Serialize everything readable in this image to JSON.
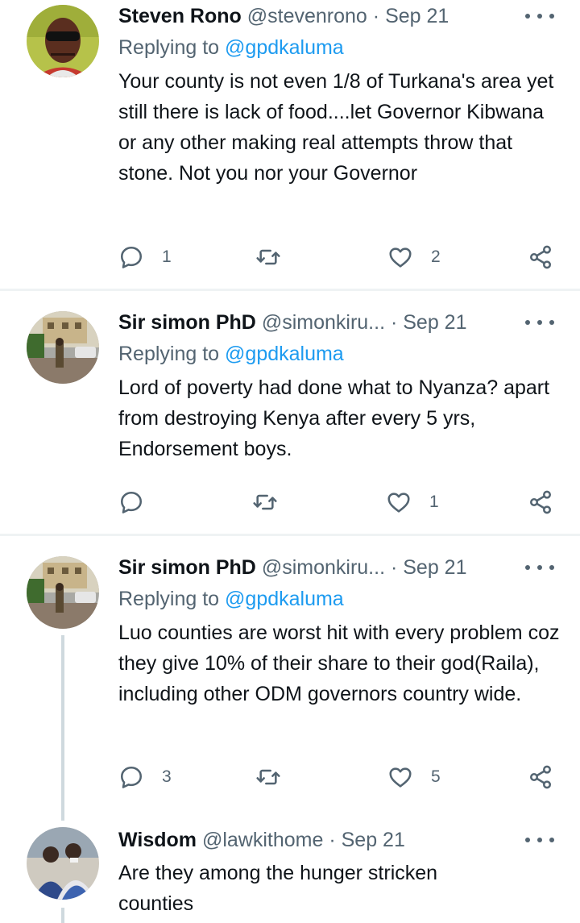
{
  "tweets": [
    {
      "name": "Steven Rono",
      "handle": "@stevenrono",
      "dot": "·",
      "time": "Sep 21",
      "replying_prefix": "Replying to ",
      "replying_to": "@gpdkaluma",
      "text": "Your county is not even 1/8 of Turkana's area yet still there is lack of food....let Governor Kibwana or any other making real attempts throw that stone. Not you nor your Governor",
      "reply_count": "1",
      "retweet_count": "",
      "like_count": "2"
    },
    {
      "name": "Sir simon PhD",
      "handle": "@simonkiru...",
      "dot": "·",
      "time": "Sep 21",
      "replying_prefix": "Replying to ",
      "replying_to": "@gpdkaluma",
      "text": "Lord of poverty had done what to Nyanza? apart from destroying Kenya after every 5 yrs, Endorsement boys.",
      "reply_count": "",
      "retweet_count": "",
      "like_count": "1"
    },
    {
      "name": "Sir simon PhD",
      "handle": "@simonkiru...",
      "dot": "·",
      "time": "Sep 21",
      "replying_prefix": "Replying to ",
      "replying_to": "@gpdkaluma",
      "text": "Luo counties are worst hit with every problem coz they give 10% of their share to their god(Raila), including other ODM governors country wide.",
      "reply_count": "3",
      "retweet_count": "",
      "like_count": "5"
    },
    {
      "name": "Wisdom",
      "handle": "@lawkithome",
      "dot": "·",
      "time": "Sep 21",
      "text": "Are they among the hunger stricken counties"
    }
  ],
  "icons": {
    "reply": "reply-icon",
    "retweet": "retweet-icon",
    "like": "heart-icon",
    "share": "share-icon",
    "more": "more-icon"
  },
  "colors": {
    "text": "#0f1419",
    "secondary": "#536471",
    "mention": "#1d9bf0",
    "divider": "#eff3f4",
    "thread": "#cfd9de"
  }
}
